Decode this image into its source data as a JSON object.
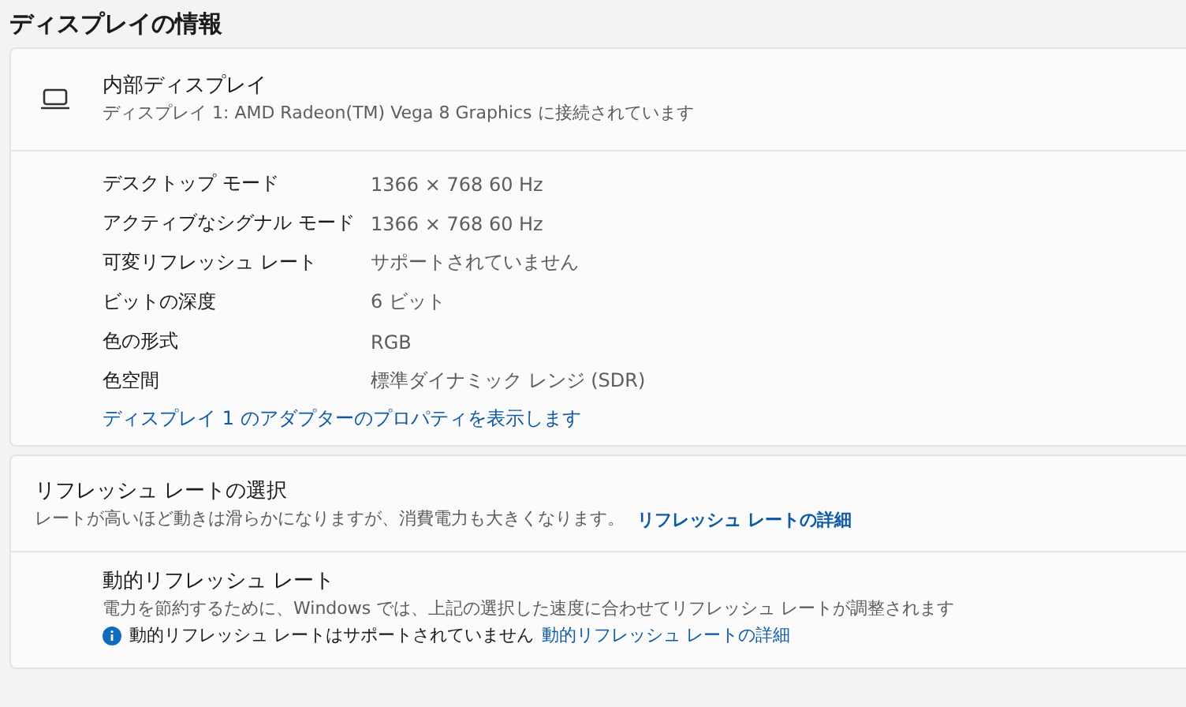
{
  "page_title": "ディスプレイの情報",
  "display_card": {
    "title": "内部ディスプレイ",
    "subtitle": "ディスプレイ 1: AMD Radeon(TM) Vega 8 Graphics に接続されています",
    "properties": [
      {
        "label": "デスクトップ モード",
        "value": "1366 × 768 60 Hz"
      },
      {
        "label": "アクティブなシグナル モード",
        "value": "1366 × 768 60 Hz"
      },
      {
        "label": "可変リフレッシュ レート",
        "value": "サポートされていません"
      },
      {
        "label": "ビットの深度",
        "value": "6 ビット"
      },
      {
        "label": "色の形式",
        "value": "RGB"
      },
      {
        "label": "色空間",
        "value": "標準ダイナミック レンジ (SDR)"
      }
    ],
    "adapter_link": "ディスプレイ 1 のアダプターのプロパティを表示します"
  },
  "refresh_card": {
    "title": "リフレッシュ レートの選択",
    "description": "レートが高いほど動きは滑らかになりますが、消費電力も大きくなります。",
    "link": "リフレッシュ レートの詳細",
    "dynamic": {
      "title": "動的リフレッシュ レート",
      "description": "電力を節約するために、Windows では、上記の選択した速度に合わせてリフレッシュ レートが調整されます",
      "notice": "動的リフレッシュ レートはサポートされていません",
      "link": "動的リフレッシュ レートの詳細"
    }
  }
}
